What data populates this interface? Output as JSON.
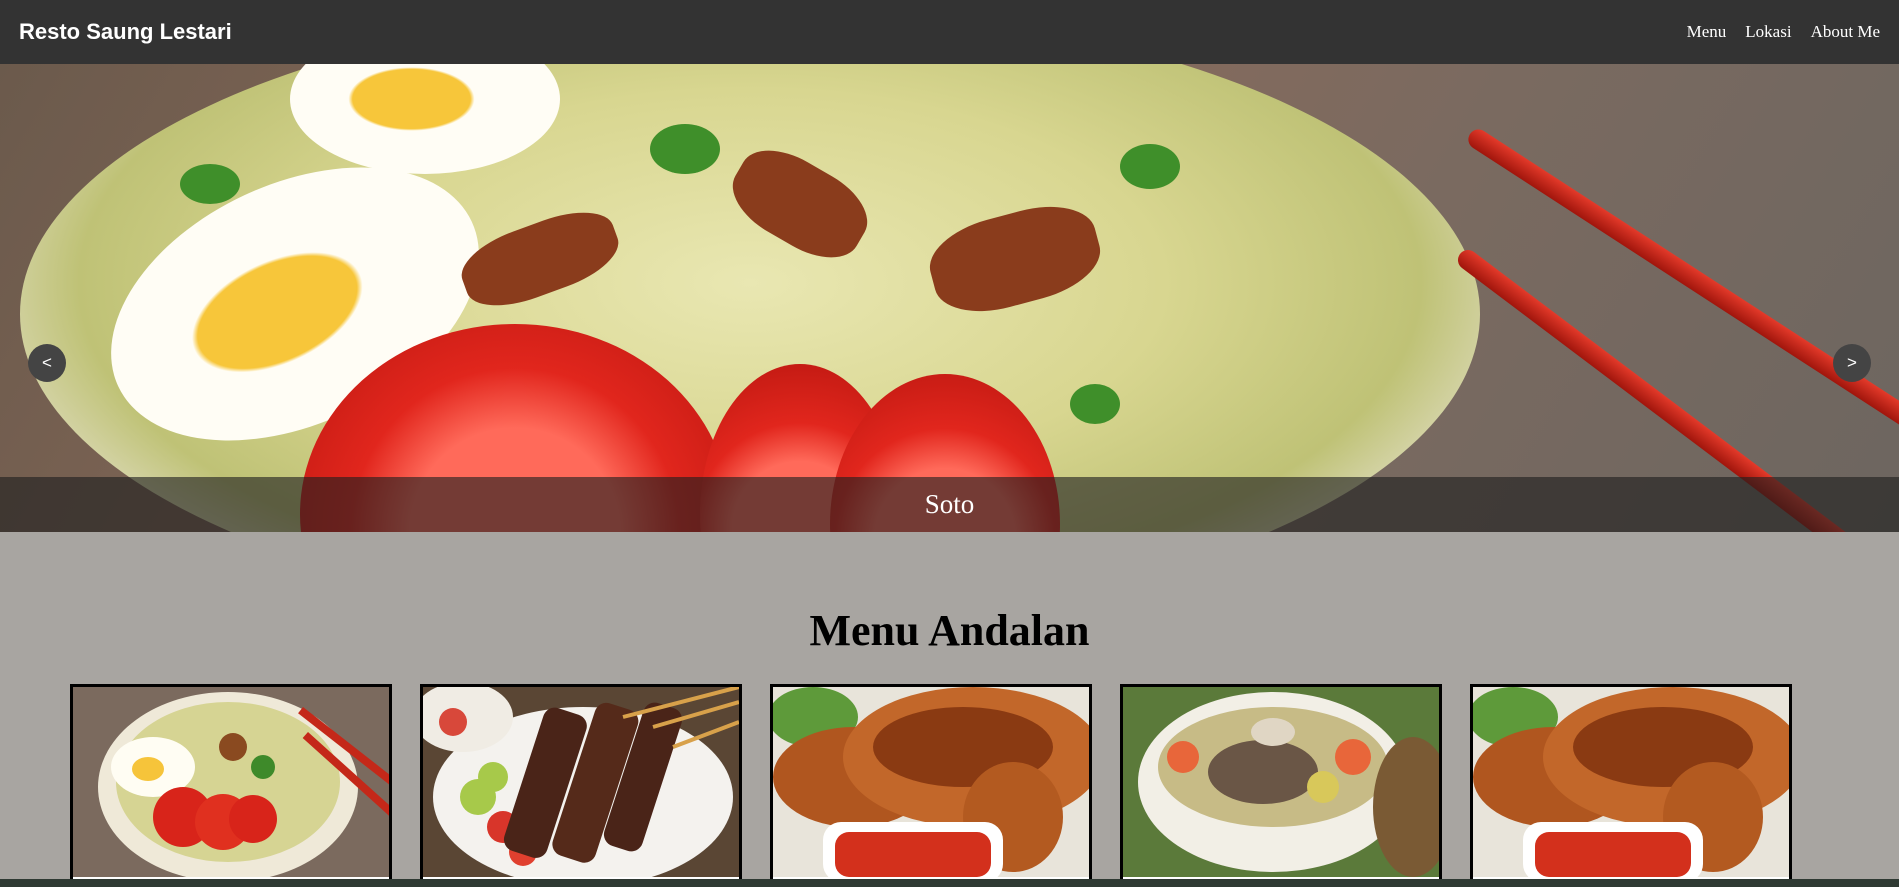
{
  "navbar": {
    "brand": "Resto Saung Lestari",
    "links": [
      "Menu",
      "Lokasi",
      "About Me"
    ]
  },
  "carousel": {
    "prev_label": "<",
    "next_label": ">",
    "caption": "Soto"
  },
  "section": {
    "title": "Menu Andalan"
  },
  "cards": [
    {
      "dish": "soto"
    },
    {
      "dish": "sate"
    },
    {
      "dish": "ayam-bakar"
    },
    {
      "dish": "sop-iga"
    },
    {
      "dish": "ayam-bakar"
    }
  ],
  "colors": {
    "navbar": "#333333",
    "page_background": "#a8a5a1",
    "caption_bar": "rgba(30,30,30,0.62)"
  }
}
